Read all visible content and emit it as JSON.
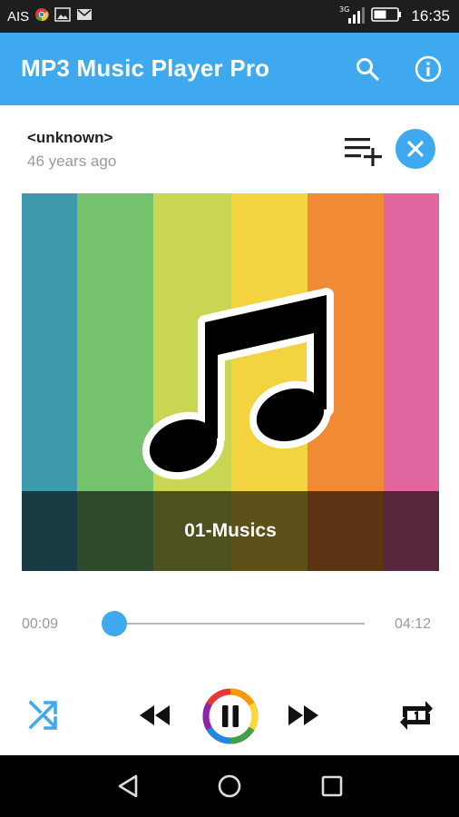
{
  "status_bar": {
    "carrier": "AIS",
    "network": "3G",
    "time": "16:35",
    "icons": [
      "chrome-icon",
      "image-icon",
      "gmail-icon",
      "signal-icon",
      "battery-icon"
    ]
  },
  "app_bar": {
    "title": "MP3 Music Player Pro",
    "actions": [
      {
        "name": "search",
        "icon": "search-icon"
      },
      {
        "name": "info",
        "icon": "info-icon"
      }
    ]
  },
  "song": {
    "artist": "<unknown>",
    "added": "46 years ago",
    "title": "01-Musics"
  },
  "artwork": {
    "stripe_colors": [
      "#3f9aad",
      "#76c36e",
      "#c8d653",
      "#f3d340",
      "#f08a35",
      "#e2669f"
    ],
    "icon": "music-note-icon"
  },
  "playback": {
    "current_time": "00:09",
    "total_time": "04:12",
    "progress_fraction": 0.036,
    "state": "playing",
    "controls": [
      "shuffle-icon",
      "previous-icon",
      "pause-icon",
      "next-icon",
      "repeat-one-icon"
    ]
  },
  "colors": {
    "accent": "#3ea9ee",
    "status_bar": "#1e1e1e",
    "nav_bar": "#000000"
  },
  "nav_bar": {
    "buttons": [
      "back-icon",
      "home-icon",
      "recents-icon"
    ]
  }
}
